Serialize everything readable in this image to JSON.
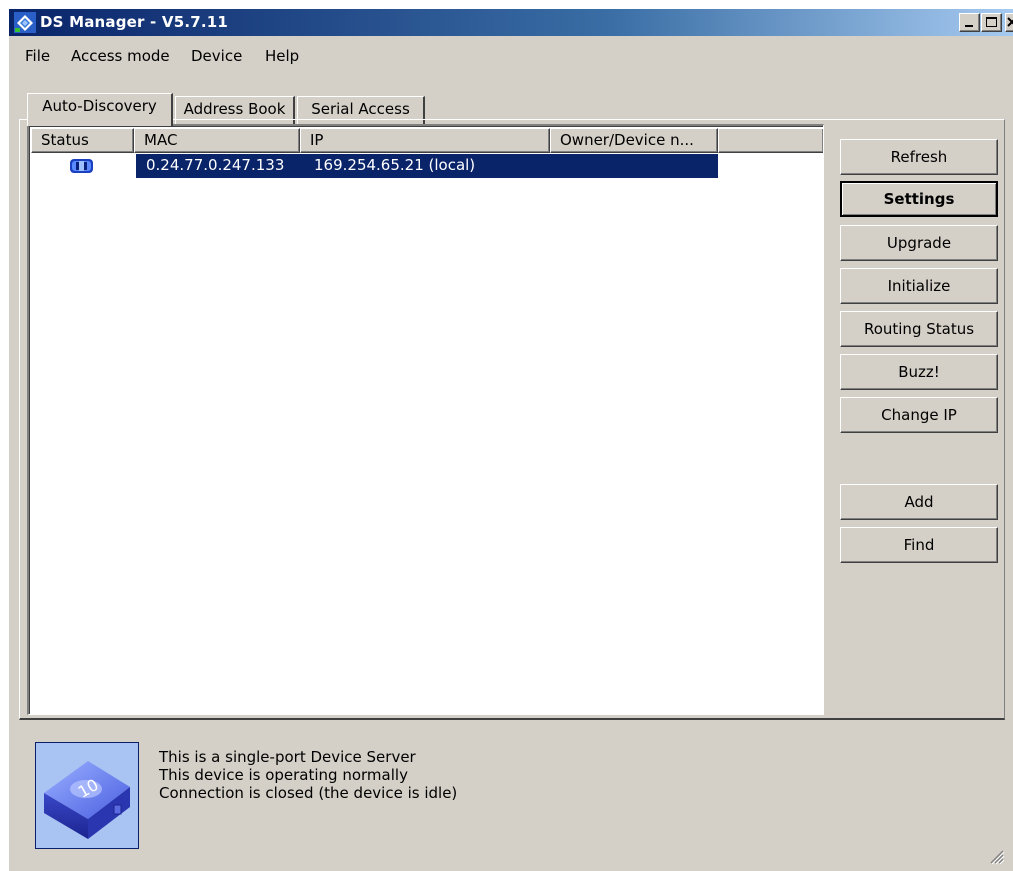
{
  "window": {
    "title": "DS Manager - V5.7.11"
  },
  "menu": [
    "File",
    "Access mode",
    "Device",
    "Help"
  ],
  "tabs": [
    "Auto-Discovery",
    "Address Book",
    "Serial Access"
  ],
  "table": {
    "columns": [
      "Status",
      "MAC",
      "IP",
      "Owner/Device n..."
    ],
    "rows": [
      {
        "status_icon": "device-running-icon",
        "mac": "0.24.77.0.247.133",
        "ip": "169.254.65.21 (local)",
        "owner": ""
      }
    ]
  },
  "buttons": {
    "refresh": "Refresh",
    "settings": "Settings",
    "upgrade": "Upgrade",
    "initialize": "Initialize",
    "routing_status": "Routing Status",
    "buzz": "Buzz!",
    "change_ip": "Change IP",
    "add": "Add",
    "find": "Find"
  },
  "info": {
    "line1": "This is a single-port Device Server",
    "line2": "This device is operating normally",
    "line3": "Connection is closed (the device is idle)"
  },
  "colors": {
    "selection": "#0a246a",
    "title_gradient_start": "#0a246a",
    "title_gradient_end": "#a6caf0",
    "face": "#d4d0c8"
  }
}
